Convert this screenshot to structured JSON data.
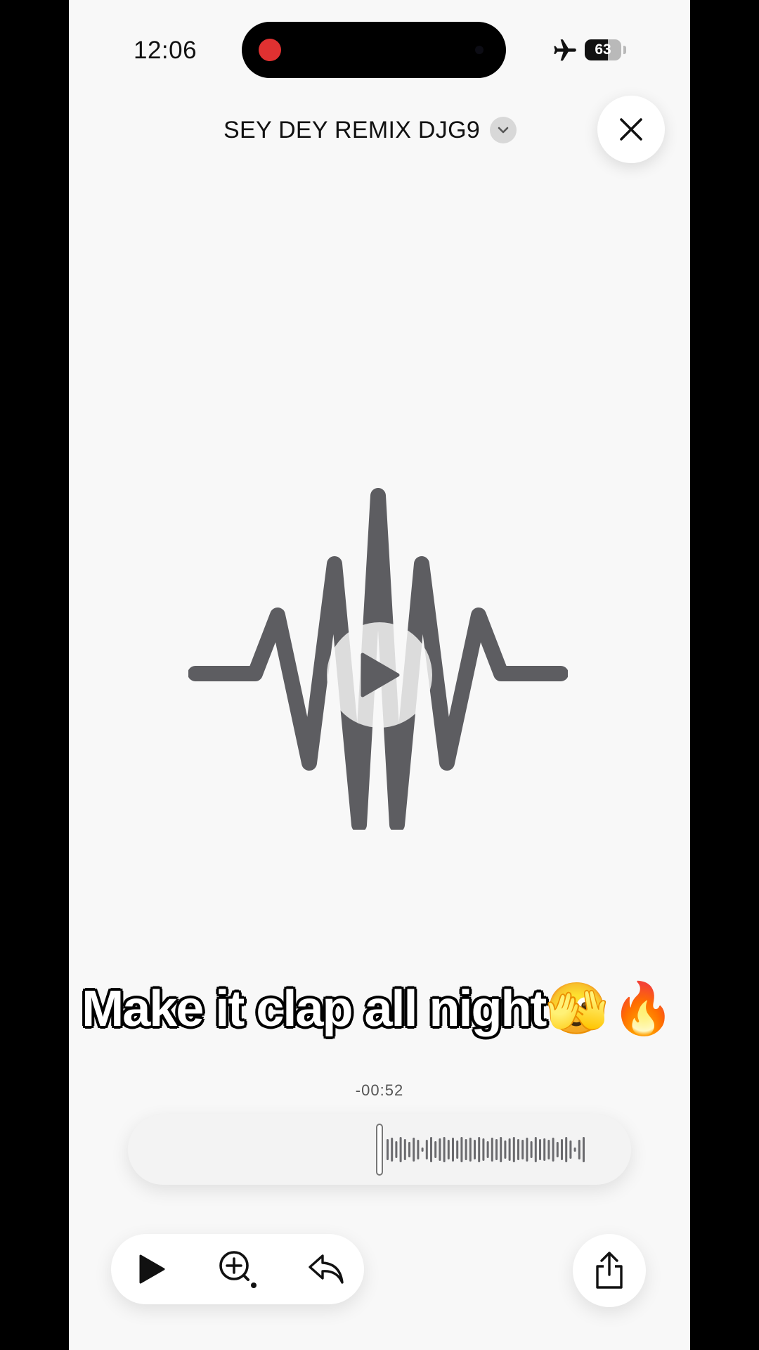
{
  "status_bar": {
    "time": "12:06",
    "battery_level": "63",
    "battery_fraction": 0.63,
    "airplane_mode": true,
    "recording_indicator_color": "#e03131"
  },
  "header": {
    "title": "SEY DEY REMIX DJG9",
    "chevron_icon": "chevron-down-icon",
    "close_icon": "close-icon"
  },
  "artwork": {
    "icon": "waveform-icon",
    "play_icon": "play-icon",
    "color": "#5d5d61"
  },
  "caption": {
    "text": "Make it clap all night",
    "emoji": "🫣🔥"
  },
  "player": {
    "time_remaining": "-00:52",
    "playhead_fraction": 0.5
  },
  "controls": {
    "play_icon": "play-icon",
    "zoom_icon": "zoom-in-icon",
    "reply_icon": "reply-icon",
    "share_icon": "share-icon"
  }
}
